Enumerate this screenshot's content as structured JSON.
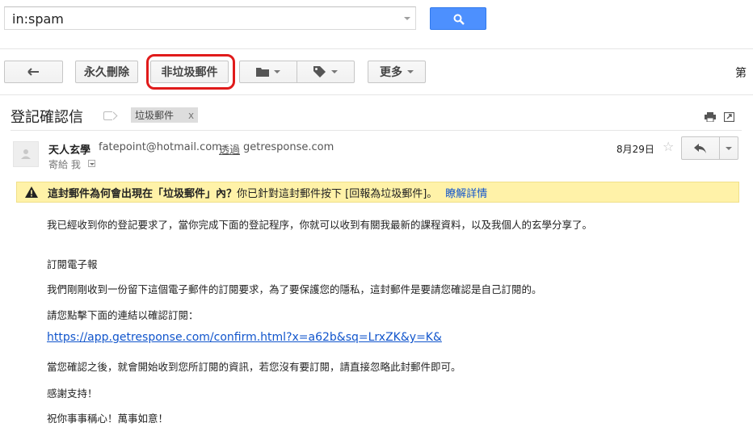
{
  "search": {
    "query": "in:spam"
  },
  "toolbar": {
    "delete_forever": "永久刪除",
    "not_spam": "非垃圾郵件",
    "more": "更多",
    "page_indicator": "第"
  },
  "message": {
    "subject": "登記確認信",
    "label_chip": "垃圾郵件",
    "label_chip_remove": "x",
    "sender_name": "天人玄學",
    "sender_email": "fatepoint@hotmail.com",
    "via_label": "透過",
    "via_domain": "getresponse.com",
    "to_line": "寄給 我",
    "date": "8月29日",
    "star": "☆"
  },
  "warning": {
    "question": "這封郵件為何會出現在「垃圾郵件」內？",
    "explanation": "你已針對這封郵件按下 [回報為垃圾郵件]。",
    "learn_more": "瞭解詳情"
  },
  "body": {
    "line1": "我已經收到你的登記要求了，當你完成下面的登記程序，你就可以收到有關我最新的課程資料，以及我個人的玄學分享了。",
    "line2": "訂閱電子報",
    "line3": "我們剛剛收到一份留下這個電子郵件的訂閱要求，為了要保護您的隱私，這封郵件是要請您確認是自己訂閱的。",
    "line4": "請您點擊下面的連結以確認訂閱：",
    "link": "https://app.getresponse.com/confirm.html?x=a62b&sq=LrxZK&y=K&",
    "line5": "當您確認之後，就會開始收到您所訂閱的資訊，若您沒有要訂閱，請直接忽略此封郵件即可。",
    "line6": "感謝支持！",
    "line7": "祝你事事稱心！萬事如意！"
  }
}
